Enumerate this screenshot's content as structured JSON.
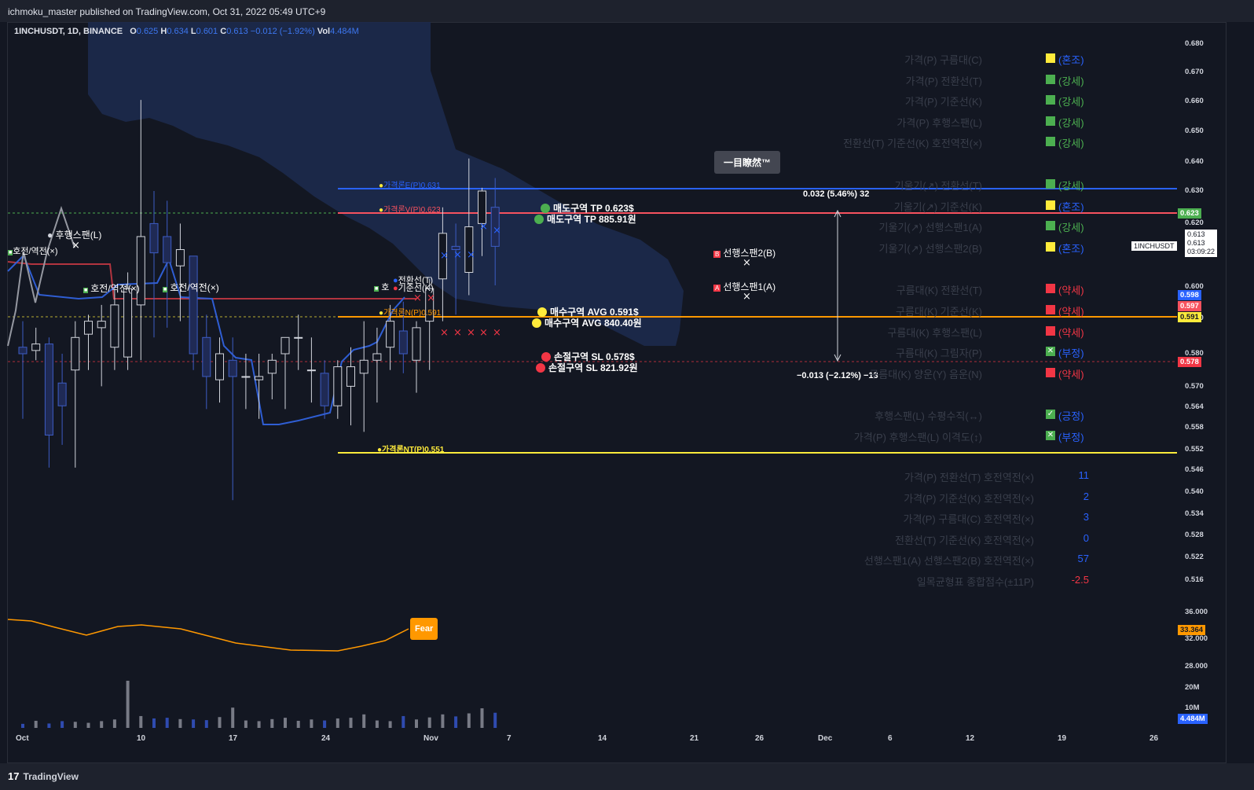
{
  "header": {
    "published": "ichmoku_master published on TradingView.com, Oct 31, 2022 05:49 UTC+9"
  },
  "footer": {
    "brand": "TradingView",
    "logo_text": "17"
  },
  "legend": {
    "symbol": "1INCHUSDT, 1D, BINANCE",
    "o_key": "O",
    "o_val": "0.625",
    "h_key": "H",
    "h_val": "0.634",
    "l_key": "L",
    "l_val": "0.601",
    "c_key": "C",
    "c_val": "0.613",
    "change": "−0.012 (−1.92%)",
    "vol_key": "Vol",
    "vol_val": "4.484M"
  },
  "price_axis": [
    "0.680",
    "0.670",
    "0.660",
    "0.650",
    "0.640",
    "0.630",
    "0.620",
    "0.610",
    "0.600",
    "0.590",
    "0.580",
    "0.570",
    "0.564",
    "0.558",
    "0.552",
    "0.546",
    "0.540",
    "0.534",
    "0.528",
    "0.522",
    "0.516",
    "36.000",
    "32.000",
    "28.000",
    "20M",
    "10M"
  ],
  "price_badges": {
    "p623": "0.623",
    "p598": "0.598",
    "p597": "0.597",
    "p591": "0.591",
    "p578": "0.578",
    "fg": "33.364",
    "vol": "4.484M",
    "close1": "0.613",
    "close2": "0.613",
    "countdown": "03:09:22",
    "symtag": "1INCHUSDT"
  },
  "time_axis": [
    "Oct",
    "10",
    "17",
    "24",
    "Nov",
    "7",
    "14",
    "21",
    "26",
    "Dec",
    "6",
    "12",
    "19",
    "26"
  ],
  "tooltip": "一目瞭然™",
  "fear_label": "Fear",
  "measure": {
    "up": "0.032 (5.46%) 32",
    "down": "−0.013 (−2.12%) −13"
  },
  "annotations": {
    "tp_usd": "매도구역 TP 0.623$",
    "tp_krw": "매도구역 TP 885.91원",
    "avg_usd": "매수구역 AVG 0.591$",
    "avg_krw": "매수구역 AVG 840.40원",
    "sl_usd": "손절구역 SL 0.578$",
    "sl_krw": "손절구역 SL 821.92원",
    "e_line": "가격론E(P)0.631",
    "v_line": "가격론V(P)0.623",
    "n_line": "가격론N(P)0.591",
    "nt_line": "가격론NT(P)0.551",
    "span_b": "선행스팬2(B)",
    "span_a": "선행스팬1(A)",
    "lagging": "후행스팬(L)",
    "cross1": "호전/역전(×)",
    "cross2": "호전/역전(×)",
    "cross3": "호전/역전(×)",
    "tenkan": "전환선(T)",
    "kijun": "기준선(K)",
    "cross4": "호"
  },
  "status_table": [
    {
      "label": "가격(P) 구름대(C)",
      "value": "(혼조)",
      "color": "#ffeb3b",
      "vcolor": "#2962ff"
    },
    {
      "label": "가격(P) 전환선(T)",
      "value": "(강세)",
      "color": "#4caf50",
      "vcolor": "#4caf50"
    },
    {
      "label": "가격(P) 기준선(K)",
      "value": "(강세)",
      "color": "#4caf50",
      "vcolor": "#4caf50"
    },
    {
      "label": "가격(P) 후행스팬(L)",
      "value": "(강세)",
      "color": "#4caf50",
      "vcolor": "#4caf50"
    },
    {
      "label": "전환선(T) 기준선(K) 호전역전(×)",
      "value": "(강세)",
      "color": "#4caf50",
      "vcolor": "#4caf50"
    },
    {
      "label": "기울기(↗) 전환선(T)",
      "value": "(강세)",
      "color": "#4caf50",
      "vcolor": "#4caf50"
    },
    {
      "label": "기울기(↗) 기준선(K)",
      "value": "(혼조)",
      "color": "#ffeb3b",
      "vcolor": "#2962ff"
    },
    {
      "label": "기울기(↗) 선행스팬1(A)",
      "value": "(강세)",
      "color": "#4caf50",
      "vcolor": "#4caf50"
    },
    {
      "label": "기울기(↗) 선행스팬2(B)",
      "value": "(혼조)",
      "color": "#ffeb3b",
      "vcolor": "#2962ff"
    },
    {
      "label": "구름대(K) 전환선(T)",
      "value": "(약세)",
      "color": "#f23645",
      "vcolor": "#f23645"
    },
    {
      "label": "구름대(K) 기준선(K)",
      "value": "(약세)",
      "color": "#f23645",
      "vcolor": "#f23645"
    },
    {
      "label": "구름대(K) 후행스팬(L)",
      "value": "(약세)",
      "color": "#f23645",
      "vcolor": "#f23645"
    },
    {
      "label": "구름대(K) 그림자(P)",
      "value": "(부정)",
      "color": "#4caf50",
      "vcolor": "#2962ff"
    },
    {
      "label": "구름대(K) 양운(Y) 음운(N)",
      "value": "(약세)",
      "color": "#f23645",
      "vcolor": "#f23645"
    },
    {
      "label": "후행스팬(L) 수평수직(↔)",
      "value": "(긍정)",
      "color": "#4caf50",
      "vcolor": "#2962ff"
    },
    {
      "label": "가격(P) 후행스팬(L) 이격도(↕)",
      "value": "(부정)",
      "color": "#4caf50",
      "vcolor": "#2962ff"
    }
  ],
  "count_table": [
    {
      "label": "가격(P) 전환선(T) 호전역전(×)",
      "value": "11",
      "vcolor": "#2962ff"
    },
    {
      "label": "가격(P) 기준선(K) 호전역전(×)",
      "value": "2",
      "vcolor": "#2962ff"
    },
    {
      "label": "가격(P) 구름대(C) 호전역전(×)",
      "value": "3",
      "vcolor": "#2962ff"
    },
    {
      "label": "전환선(T) 기준선(K) 호전역전(×)",
      "value": "0",
      "vcolor": "#2962ff"
    },
    {
      "label": "선행스팬1(A) 선행스팬2(B) 호전역전(×)",
      "value": "57",
      "vcolor": "#2962ff"
    },
    {
      "label": "일목균형표 종합점수(±11P)",
      "value": "-2.5",
      "vcolor": "#f23645"
    }
  ],
  "chart_data": {
    "type": "candlestick",
    "ohlc": [
      [
        0.582,
        0.59,
        0.56,
        0.58
      ],
      [
        0.581,
        0.588,
        0.578,
        0.583
      ],
      [
        0.583,
        0.585,
        0.545,
        0.555
      ],
      [
        0.571,
        0.58,
        0.552,
        0.564
      ],
      [
        0.575,
        0.59,
        0.545,
        0.585
      ],
      [
        0.586,
        0.592,
        0.575,
        0.59
      ],
      [
        0.588,
        0.595,
        0.57,
        0.59
      ],
      [
        0.582,
        0.6,
        0.575,
        0.595
      ],
      [
        0.579,
        0.605,
        0.575,
        0.6
      ],
      [
        0.595,
        0.658,
        0.578,
        0.616
      ],
      [
        0.62,
        0.63,
        0.585,
        0.611
      ],
      [
        0.616,
        0.627,
        0.588,
        0.608
      ],
      [
        0.607,
        0.62,
        0.59,
        0.612
      ],
      [
        0.61,
        0.61,
        0.575,
        0.58
      ],
      [
        0.585,
        0.592,
        0.563,
        0.573
      ],
      [
        0.572,
        0.585,
        0.565,
        0.58
      ],
      [
        0.578,
        0.585,
        0.535,
        0.573
      ],
      [
        0.573,
        0.58,
        0.563,
        0.573
      ],
      [
        0.572,
        0.58,
        0.56,
        0.573
      ],
      [
        0.574,
        0.58,
        0.566,
        0.578
      ],
      [
        0.58,
        0.585,
        0.563,
        0.585
      ],
      [
        0.585,
        0.592,
        0.575,
        0.585
      ],
      [
        0.575,
        0.585,
        0.565,
        0.575
      ],
      [
        0.574,
        0.578,
        0.56,
        0.564
      ],
      [
        0.564,
        0.578,
        0.56,
        0.576
      ],
      [
        0.57,
        0.582,
        0.558,
        0.576
      ],
      [
        0.574,
        0.59,
        0.556,
        0.578
      ],
      [
        0.578,
        0.588,
        0.565,
        0.58
      ],
      [
        0.582,
        0.595,
        0.575,
        0.59
      ],
      [
        0.587,
        0.596,
        0.574,
        0.58
      ],
      [
        0.578,
        0.59,
        0.568,
        0.588
      ],
      [
        0.59,
        0.603,
        0.575,
        0.6
      ],
      [
        0.603,
        0.625,
        0.59,
        0.617
      ],
      [
        0.613,
        0.62,
        0.592,
        0.612
      ],
      [
        0.605,
        0.64,
        0.598,
        0.619
      ],
      [
        0.62,
        0.631,
        0.61,
        0.63
      ],
      [
        0.625,
        0.634,
        0.601,
        0.613
      ]
    ],
    "volume_series_m": [
      1.2,
      2.1,
      1.3,
      2.0,
      1.8,
      1.5,
      2.0,
      2.5,
      14.0,
      3.5,
      2.8,
      3.0,
      2.6,
      2.5,
      2.3,
      3.2,
      6.0,
      2.2,
      2.0,
      2.6,
      3.0,
      2.1,
      2.5,
      2.2,
      2.8,
      3.0,
      4.0,
      2.2,
      2.0,
      3.5,
      2.5,
      3.1,
      4.0,
      3.4,
      4.3,
      5.8,
      4.484
    ],
    "fear_greed": [
      33.364
    ],
    "levels": {
      "E": 0.631,
      "V": 0.623,
      "N": 0.591,
      "NT": 0.551,
      "TP": 0.623,
      "AVG": 0.591,
      "SL": 0.578
    }
  }
}
